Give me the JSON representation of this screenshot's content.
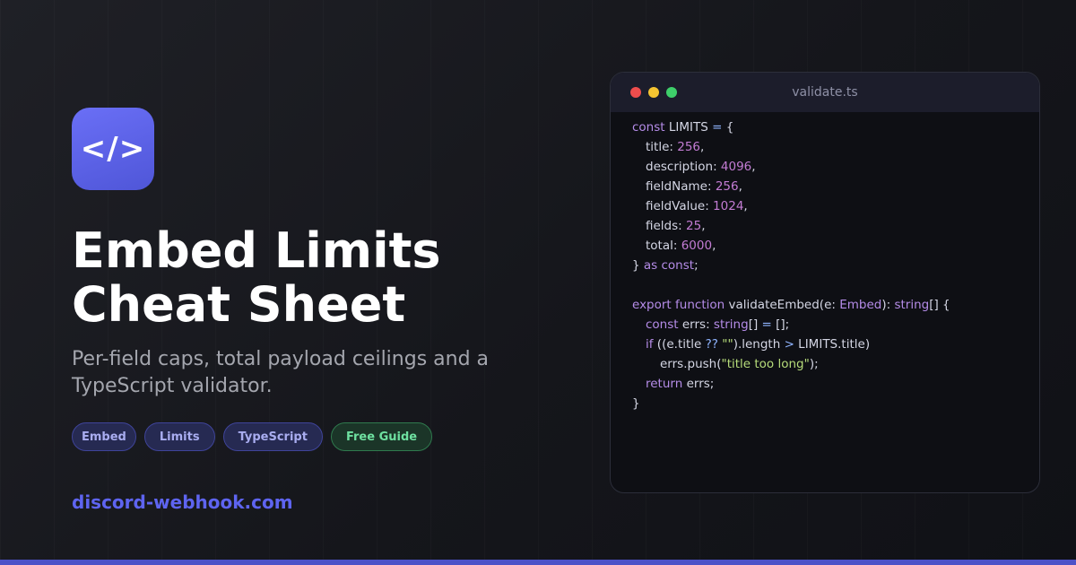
{
  "brand": {
    "logo_glyph": "</>",
    "domain": "discord-webhook.com",
    "accent_color": "#5e64f0"
  },
  "hero": {
    "title_line1": "Embed Limits",
    "title_line2": "Cheat Sheet",
    "subtitle": "Per-field caps, total payload ceilings and a TypeScript validator."
  },
  "tags": [
    "Embed",
    "Limits",
    "TypeScript",
    "Free Guide"
  ],
  "code_window": {
    "filename": "validate.ts",
    "window_controls": [
      "close-dot",
      "minimize-dot",
      "maximize-dot"
    ],
    "lines": {
      "l1": {
        "kw": "const",
        "rest": " LIMITS ",
        "op": "=",
        "tail": " {"
      },
      "l2": {
        "key": "title",
        "num": "256"
      },
      "l3": {
        "key": "description",
        "num": "4096"
      },
      "l4": {
        "key": "fieldName",
        "num": "256"
      },
      "l5": {
        "key": "fieldValue",
        "num": "1024"
      },
      "l6": {
        "key": "fields",
        "num": "25"
      },
      "l7": {
        "key": "total",
        "num": "6000"
      },
      "l8": {
        "open": "} ",
        "kw1": "as",
        "kw2": "const",
        "tail": ";"
      },
      "l10": {
        "kw1": "export",
        "kw2": "function",
        "name": " validateEmbed(e: ",
        "type1": "Embed",
        "mid": "): ",
        "type2": "string",
        "tail": "[] {"
      },
      "l11": {
        "kw": "const",
        "mid": " errs: ",
        "type": "string",
        "mid2": "[] ",
        "op": "=",
        "tail": " [];"
      },
      "l12": {
        "kw": "if",
        "a": " ((e.title ",
        "op1": "??",
        "b": " ",
        "str": "\"\"",
        "c": ").length ",
        "op2": ">",
        "d": " LIMITS.title)"
      },
      "l13": {
        "a": "errs.push(",
        "str": "\"title too long\"",
        "tail": ");"
      },
      "l14": {
        "kw": "return",
        "tail": " errs;"
      },
      "l15": {
        "close": "}"
      }
    }
  }
}
